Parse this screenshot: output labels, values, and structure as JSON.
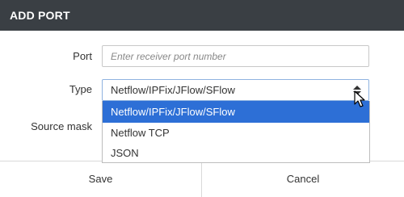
{
  "dialog": {
    "title": "ADD PORT"
  },
  "form": {
    "port_label": "Port",
    "port_value": "",
    "port_placeholder": "Enter receiver port number",
    "type_label": "Type",
    "type_selected": "Netflow/IPFix/JFlow/SFlow",
    "source_mask_label": "Source mask",
    "type_options": [
      {
        "label": "Netflow/IPFix/JFlow/SFlow",
        "highlighted": true
      },
      {
        "label": "Netflow TCP",
        "highlighted": false
      },
      {
        "label": "JSON",
        "highlighted": false
      }
    ]
  },
  "footer": {
    "save_label": "Save",
    "cancel_label": "Cancel"
  },
  "colors": {
    "header_bg": "#3a3f44",
    "highlight": "#2d6fd6",
    "focus_border": "#8fb3e0"
  },
  "icons": {
    "select_arrows": "sort-updown-icon",
    "pointer": "mouse-cursor-icon"
  }
}
